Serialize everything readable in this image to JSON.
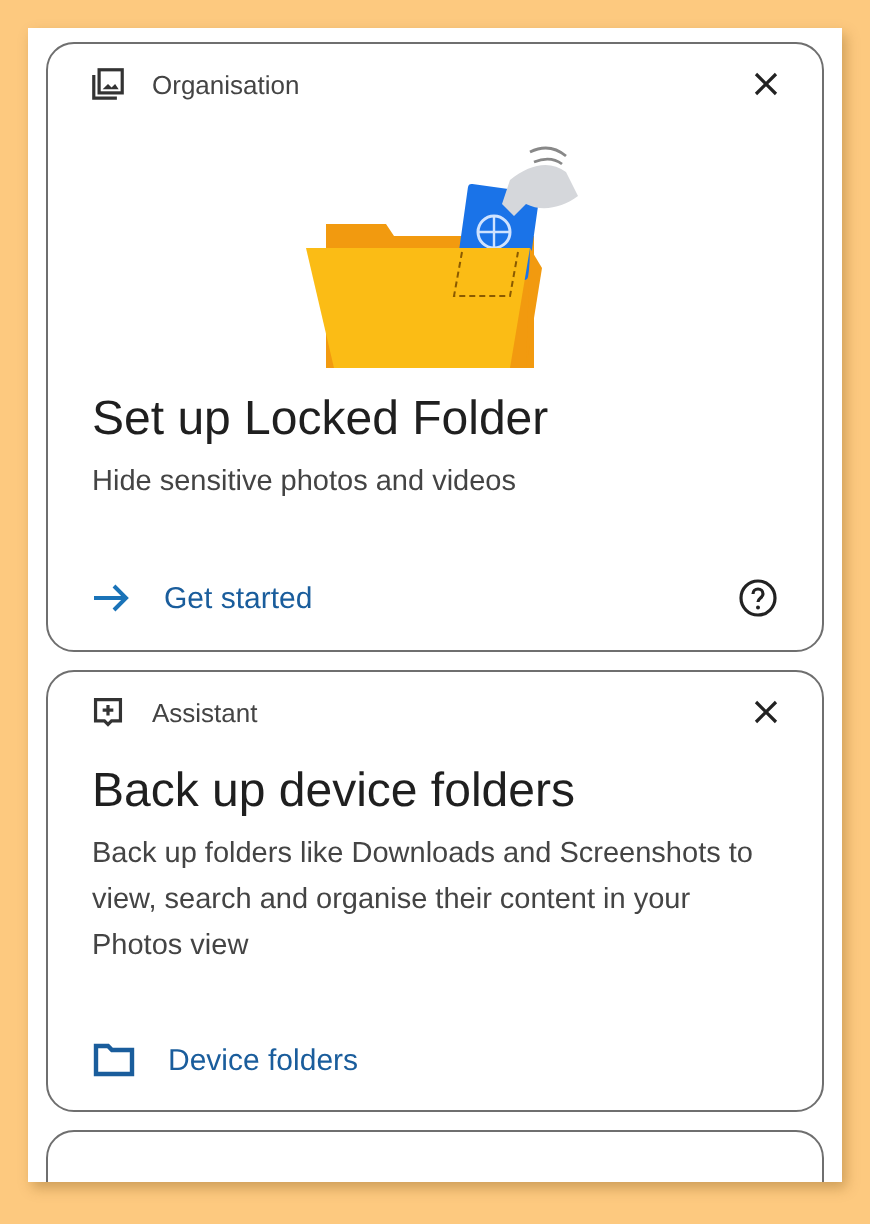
{
  "cards": [
    {
      "kind": "locked-folder",
      "category": "Organisation",
      "title": "Set up Locked Folder",
      "body": "Hide sensitive photos and videos",
      "action": "Get started"
    },
    {
      "kind": "device-folders",
      "category": "Assistant",
      "title": "Back up device folders",
      "body": "Back up folders like Downloads and Screenshots to view, search and organise their content in your Photos view",
      "action": "Device folders"
    },
    {
      "kind": "cut"
    }
  ]
}
